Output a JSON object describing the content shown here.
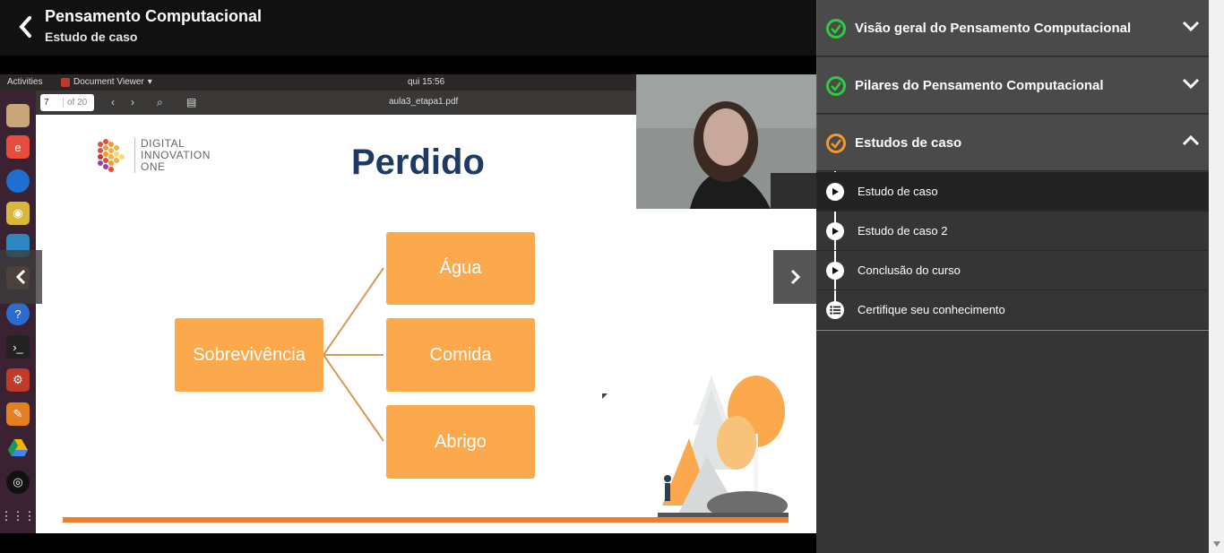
{
  "header": {
    "course_title": "Pensamento Computacional",
    "lesson_title": "Estudo de caso"
  },
  "desktop": {
    "activities": "Activities",
    "app_name": "Document Viewer",
    "clock": "qui 15:56",
    "page_number": "7",
    "page_total": "of 20",
    "filename": "aula3_etapa1.pdf"
  },
  "slide": {
    "logo_line1": "DIGITAL",
    "logo_line2": "INNOVATION",
    "logo_line3": "ONE",
    "title": "Perdido",
    "center_box": "Sobrevivência",
    "box1": "Água",
    "box2": "Comida",
    "box3": "Abrigo"
  },
  "sidebar": {
    "sections": [
      {
        "label": "Visão geral do Pensamento Computacional",
        "status": "complete",
        "expanded": false
      },
      {
        "label": "Pilares do Pensamento Computacional",
        "status": "complete",
        "expanded": false
      },
      {
        "label": "Estudos de caso",
        "status": "in-progress",
        "expanded": true
      }
    ],
    "lessons": [
      {
        "label": "Estudo de caso",
        "icon": "play-icon",
        "active": true
      },
      {
        "label": "Estudo de caso 2",
        "icon": "play-icon",
        "active": false
      },
      {
        "label": "Conclusão do curso",
        "icon": "play-icon",
        "active": false
      },
      {
        "label": "Certifique seu conhecimento",
        "icon": "list-icon",
        "active": false
      }
    ]
  },
  "colors": {
    "complete": "#2ecc40",
    "in_progress": "#f39a2b",
    "slide_box": "#fba94c",
    "slide_title": "#1e3a64"
  }
}
